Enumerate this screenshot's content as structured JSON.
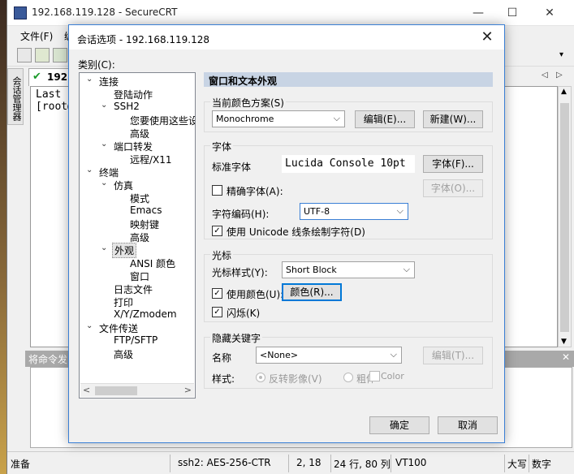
{
  "window": {
    "title": "192.168.119.128 - SecureCRT",
    "minimize": "—",
    "maximize": "☐",
    "close": "✕"
  },
  "menu": [
    "文件(F)",
    "编"
  ],
  "side_tab": "会话管理器",
  "session_tab": {
    "label": "192.1",
    "status_icon": "check-icon"
  },
  "terminal": {
    "lines": [
      "Last l",
      "[root@"
    ]
  },
  "command_window": {
    "title": "将命令发",
    "close": "✕"
  },
  "status_bar": {
    "ready": "准备",
    "cipher": "ssh2: AES-256-CTR",
    "cursor": "2, 18",
    "size": "24 行, 80 列",
    "term": "VT100",
    "caps": "大写",
    "num": "数字"
  },
  "dialog": {
    "title": "会话选项 - 192.168.119.128",
    "close": "✕",
    "category_label": "类别(C):",
    "tree": [
      {
        "label": "连接",
        "level": 0,
        "expander": "⌄"
      },
      {
        "label": "登陆动作",
        "level": 1
      },
      {
        "label": "SSH2",
        "level": 1,
        "expander": "⌄"
      },
      {
        "label": "您要使用这些设",
        "level": 2
      },
      {
        "label": "高级",
        "level": 2
      },
      {
        "label": "端口转发",
        "level": 1,
        "expander": "⌄"
      },
      {
        "label": "远程/X11",
        "level": 2
      },
      {
        "label": "终端",
        "level": 0,
        "expander": "⌄"
      },
      {
        "label": "仿真",
        "level": 1,
        "expander": "⌄"
      },
      {
        "label": "模式",
        "level": 2
      },
      {
        "label": "Emacs",
        "level": 2
      },
      {
        "label": "映射键",
        "level": 2
      },
      {
        "label": "高级",
        "level": 2
      },
      {
        "label": "外观",
        "level": 1,
        "expander": "⌄",
        "selected": true
      },
      {
        "label": "ANSI 颜色",
        "level": 2
      },
      {
        "label": "窗口",
        "level": 2
      },
      {
        "label": "日志文件",
        "level": 1
      },
      {
        "label": "打印",
        "level": 1
      },
      {
        "label": "X/Y/Zmodem",
        "level": 1
      },
      {
        "label": "文件传送",
        "level": 0,
        "expander": "⌄"
      },
      {
        "label": "FTP/SFTP",
        "level": 1
      },
      {
        "label": "高级",
        "level": 1
      }
    ],
    "panel_title": "窗口和文本外观",
    "color_scheme": {
      "group": "当前颜色方案(S)",
      "value": "Monochrome",
      "edit": "编辑(E)...",
      "new": "新建(W)..."
    },
    "font": {
      "group": "字体",
      "standard_label": "标准字体",
      "standard_value": "Lucida Console 10pt",
      "font_button": "字体(F)...",
      "precise_label": "精确字体(A):",
      "precise_button": "字体(O)...",
      "encoding_label": "字符编码(H):",
      "encoding_value": "UTF-8",
      "unicode_label": "使用 Unicode 线条绘制字符(D)"
    },
    "cursor": {
      "group": "光标",
      "style_label": "光标样式(Y):",
      "style_value": "Short Block",
      "use_color_label": "使用颜色(U):",
      "color_button": "颜色(R)...",
      "blink_label": "闪烁(K)"
    },
    "keywords": {
      "group": "隐藏关键字",
      "name_label": "名称",
      "name_value": "<None>",
      "edit_button": "编辑(T)...",
      "style_label": "样式:",
      "reverse_label": "反转影像(V)",
      "bold_label": "粗体",
      "color_label": "Color"
    },
    "ok": "确定",
    "cancel": "取消"
  }
}
